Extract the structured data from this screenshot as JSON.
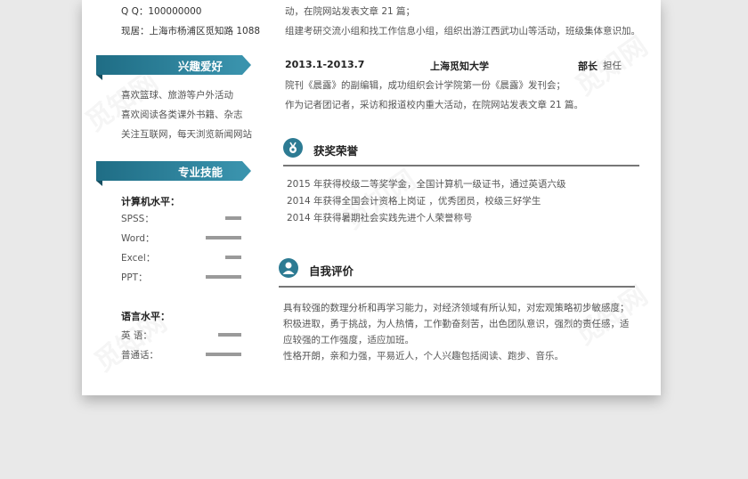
{
  "contact": {
    "qq": "Q Q：100000000",
    "address": "现居：上海市杨浦区觅知路 1088"
  },
  "hobbies": {
    "title": "兴趣爱好",
    "items": [
      "喜欢篮球、旅游等户外活动",
      "喜欢阅读各类课外书籍、杂志",
      "关注互联网，每天浏览新闻网站"
    ]
  },
  "skills": {
    "title": "专业技能",
    "computer_title": "计算机水平：",
    "computer": [
      {
        "name": "SPSS：",
        "level": 0.45
      },
      {
        "name": "Word：",
        "level": 1.0
      },
      {
        "name": "Excel：",
        "level": 0.45
      },
      {
        "name": "PPT：",
        "level": 1.0
      }
    ],
    "language_title": "语言水平：",
    "languages": [
      {
        "name": "英  语：",
        "level": 0.65
      },
      {
        "name": "普通话：",
        "level": 1.0
      }
    ]
  },
  "experience": {
    "top_lines": [
      "动，在院网站发表文章 21 篇；",
      "组建考研交流小组和找工作信息小组，组织出游江西武功山等活动，班级集体意识加。"
    ],
    "entry": {
      "date": "2013.1-2013.7",
      "org": "上海觅知大学",
      "role": "部长",
      "position": "担任",
      "lines": [
        "院刊《晨露》的副编辑，成功组织会计学院第一份《晨露》发刊会；",
        "作为记者团记者，采访和报道校内重大活动，在院网站发表文章 21 篇。"
      ]
    }
  },
  "awards": {
    "title": "获奖荣誉",
    "items": [
      "2015 年获得校级二等奖学金，全国计算机一级证书，通过英语六级",
      "2014 年获得全国会计资格上岗证 ，优秀团员，校级三好学生",
      "2014 年获得暑期社会实践先进个人荣誉称号"
    ]
  },
  "self_eval": {
    "title": "自我评价",
    "lines": [
      "具有较强的数理分析和再学习能力，对经济领域有所认知，对宏观策略初步敏感度；",
      "积极进取，勇于挑战，为人热情，工作勤奋刻苦，出色团队意识，强烈的责任感，适",
      "应较强的工作强度，适应加班。",
      "性格开朗，亲和力强，平易近人，个人兴趣包括阅读、跑步、音乐。"
    ]
  },
  "watermark": "觅知网",
  "colors": {
    "accent": "#2d7b93",
    "bar": "#9a9a9a"
  }
}
